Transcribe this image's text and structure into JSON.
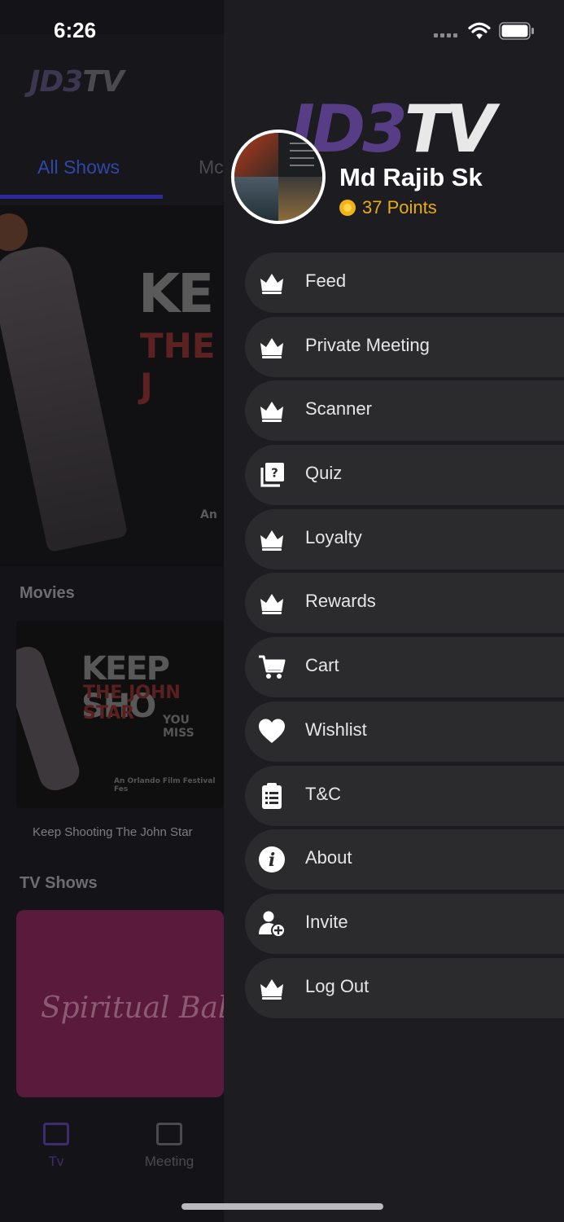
{
  "status_bar": {
    "time": "6:26"
  },
  "background": {
    "app_logo": {
      "left": "JD3",
      "right": "TV"
    },
    "tabs": [
      {
        "label": "All Shows"
      },
      {
        "label": "Mc"
      }
    ],
    "hero": {
      "title_line1": "KE",
      "title_line2": "THE J",
      "footnote": "An"
    },
    "movies_section": "Movies",
    "movie_poster": {
      "line1": "KEEP SHO",
      "line2": "THE JOHN STAR",
      "line3": "YOU MISS",
      "line4": "An Orlando Film Festival Fes"
    },
    "movie_caption": "Keep Shooting The John Star",
    "tv_section": "TV Shows",
    "tv_poster_text": "Spiritual Ball",
    "bottom_tabs": [
      {
        "label": "Tv",
        "icon": "tv-play-icon"
      },
      {
        "label": "Meeting",
        "icon": "news-icon"
      }
    ]
  },
  "drawer": {
    "brand_logo": {
      "left": "JD3",
      "right": "TV"
    },
    "user": {
      "name": "Md Rajib Sk",
      "points_label": "37 Points"
    },
    "menu": [
      {
        "label": "Feed",
        "icon": "crown-icon"
      },
      {
        "label": "Private Meeting",
        "icon": "crown-icon"
      },
      {
        "label": "Scanner",
        "icon": "crown-icon"
      },
      {
        "label": "Quiz",
        "icon": "quiz-icon"
      },
      {
        "label": "Loyalty",
        "icon": "crown-icon"
      },
      {
        "label": "Rewards",
        "icon": "crown-icon"
      },
      {
        "label": "Cart",
        "icon": "cart-icon"
      },
      {
        "label": "Wishlist",
        "icon": "heart-icon"
      },
      {
        "label": "T&C",
        "icon": "clipboard-icon"
      },
      {
        "label": "About",
        "icon": "info-icon"
      },
      {
        "label": "Invite",
        "icon": "add-user-icon"
      },
      {
        "label": "Log Out",
        "icon": "crown-icon"
      }
    ]
  },
  "colors": {
    "drawer_bg": "#1c1c21",
    "menu_item_bg": "#2b2b2d",
    "points_gold": "#e7ad18",
    "brand_purple": "#6b49a8",
    "tab_active_blue": "#2f47a8"
  }
}
